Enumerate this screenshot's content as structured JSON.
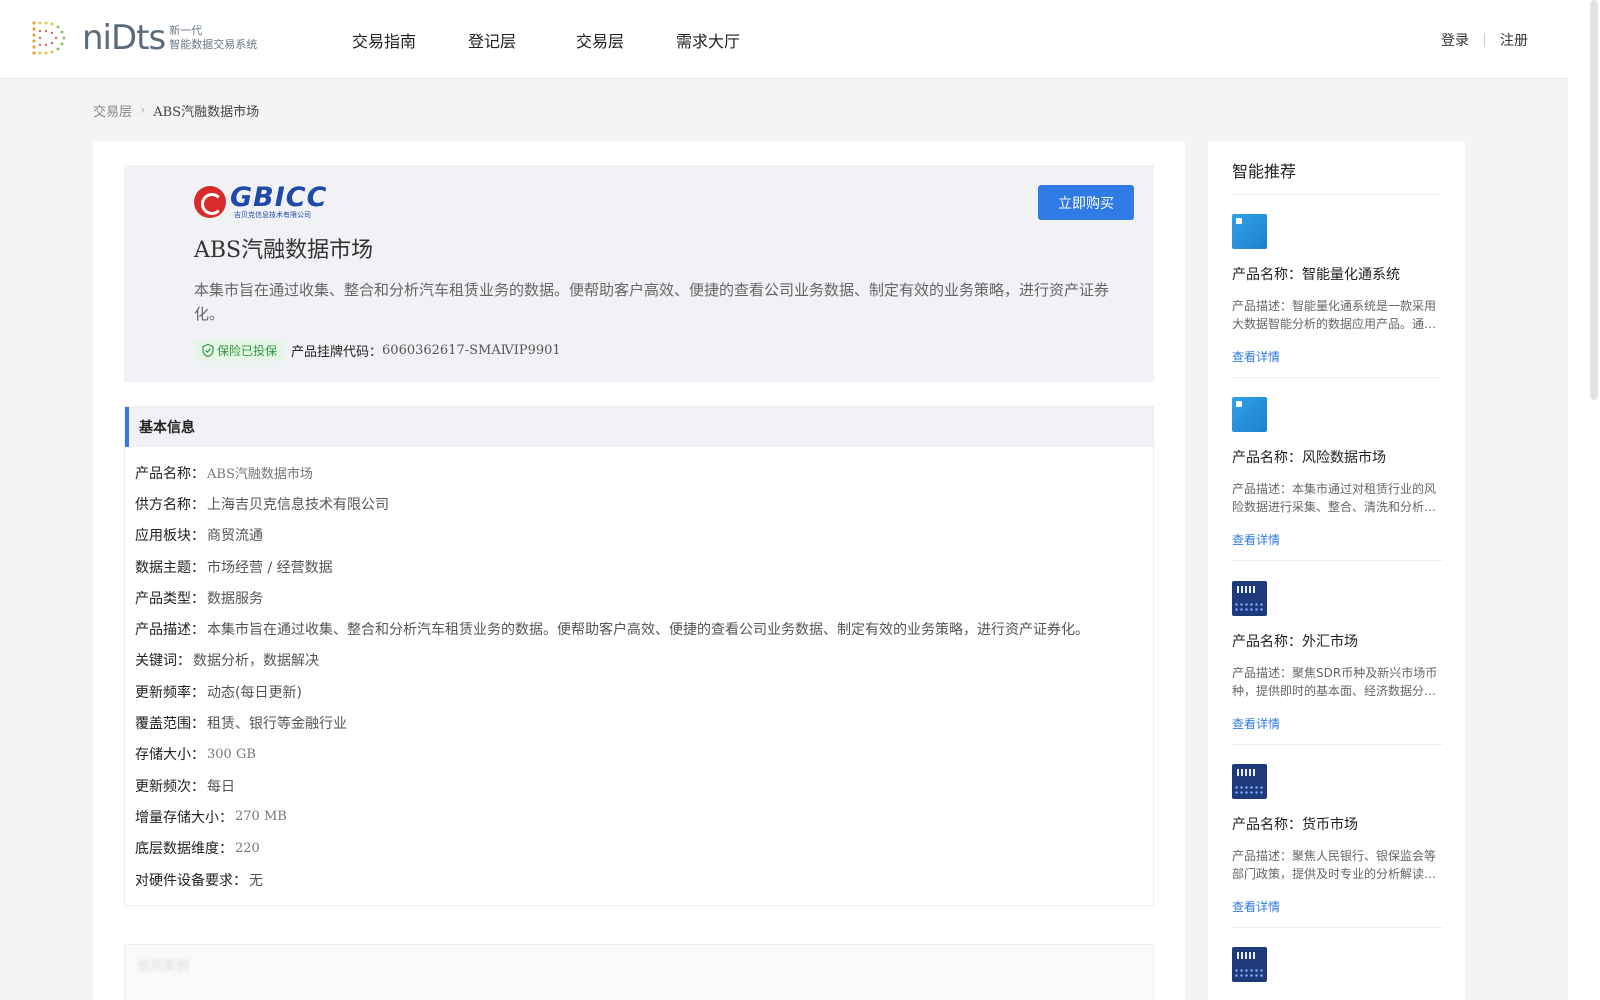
{
  "header": {
    "logo_word": "niDts",
    "logo_sub_line1": "新一代",
    "logo_sub_line2": "智能数据交易系统",
    "nav": [
      "交易指南",
      "登记层",
      "交易层",
      "需求大厅"
    ],
    "login": "登录",
    "register": "注册"
  },
  "breadcrumb": {
    "parent": "交易层",
    "current": "ABS汽融数据市场"
  },
  "hero": {
    "brand_name": "GBICC",
    "brand_subtitle": "吉贝克信息技术有限公司",
    "buy_button": "立即购买",
    "title": "ABS汽融数据市场",
    "description": "本集市旨在通过收集、整合和分析汽车租赁业务的数据。便帮助客户高效、便捷的查看公司业务数据、制定有效的业务策略，进行资产证券化。",
    "insurance_tag": "保险已投保",
    "code_label": "产品挂牌代码：",
    "code_value": "6060362617-SMAⅣIP9901"
  },
  "info": {
    "heading": "基本信息",
    "rows": [
      {
        "k": "产品名称：",
        "v": "ABS汽融数据市场"
      },
      {
        "k": "供方名称：",
        "v": "上海吉贝克信息技术有限公司"
      },
      {
        "k": "应用板块：",
        "v": "商贸流通"
      },
      {
        "k": "数据主题：",
        "v": "市场经营 / 经营数据"
      },
      {
        "k": "产品类型：",
        "v": "数据服务"
      },
      {
        "k": "产品描述：",
        "v": "本集市旨在通过收集、整合和分析汽车租赁业务的数据。便帮助客户高效、便捷的查看公司业务数据、制定有效的业务策略，进行资产证券化。"
      },
      {
        "k": "关键词：",
        "v": "数据分析，数据解决"
      },
      {
        "k": "更新频率：",
        "v": "动态(每日更新)"
      },
      {
        "k": "覆盖范围：",
        "v": "租赁、银行等金融行业"
      },
      {
        "k": "存储大小：",
        "v": "300 GB"
      },
      {
        "k": "更新频次：",
        "v": "每日"
      },
      {
        "k": "增量存储大小：",
        "v": "270 MB"
      },
      {
        "k": "底层数据维度：",
        "v": "220"
      },
      {
        "k": "对硬件设备要求：",
        "v": "无"
      }
    ]
  },
  "next_section_title": "使用案例",
  "sidebar": {
    "title": "智能推荐",
    "items": [
      {
        "name": "产品名称：智能量化通系统",
        "desc": "产品描述：智能量化通系统是一款采用大数据智能分析的数据应用产品。通过…",
        "link": "查看详情",
        "thumb": "blue"
      },
      {
        "name": "产品名称：风险数据市场",
        "desc": "产品描述：本集市通过对租赁行业的风险数据进行采集、整合、清洗和分析…",
        "link": "查看详情",
        "thumb": "blue"
      },
      {
        "name": "产品名称：外汇市场",
        "desc": "产品描述：聚焦SDR币种及新兴市场币种，提供即时的基本面、经济数据分析…",
        "link": "查看详情",
        "thumb": "dark"
      },
      {
        "name": "产品名称：货币市场",
        "desc": "产品描述：聚焦人民银行、银保监会等部门政策，提供及时专业的分析解读…",
        "link": "查看详情",
        "thumb": "dark"
      }
    ]
  },
  "colors": {
    "accent": "#2f7ae5",
    "insurance_green": "#2c9b3c",
    "brand_red": "#d82c2c",
    "brand_blue": "#1f4aa8"
  }
}
